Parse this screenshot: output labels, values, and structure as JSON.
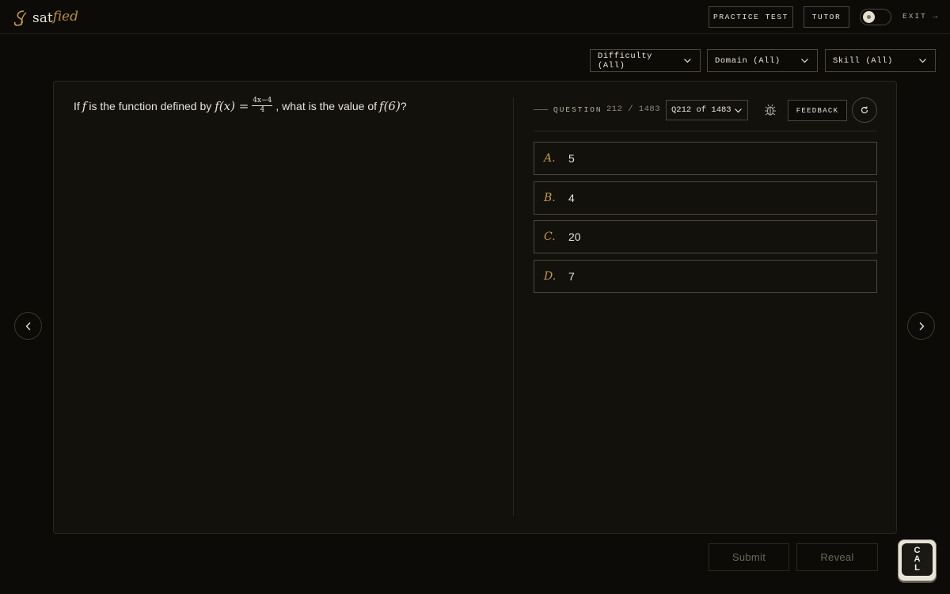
{
  "header": {
    "logo_text": "sat",
    "logo_script": "fied",
    "practice_test": "PRACTICE TEST",
    "tutor": "TUTOR",
    "exit": "EXIT →"
  },
  "filters": {
    "difficulty": "Difficulty (All)",
    "domain": "Domain (All)",
    "skill": "Skill (All)"
  },
  "question": {
    "prefix": "If ",
    "f": "f",
    "mid": " is the function defined by ",
    "fx": "f(x) =",
    "frac_num": "4x−4",
    "frac_den": "4",
    "suffix": ", what is the value of ",
    "f6": "f(6)",
    "end": "?"
  },
  "meta": {
    "label": "QUESTION",
    "count": "212 / 1483",
    "select_value": "Q212 of 1483",
    "feedback": "FEEDBACK"
  },
  "options": [
    {
      "letter": "A.",
      "text": "5"
    },
    {
      "letter": "B.",
      "text": "4"
    },
    {
      "letter": "C.",
      "text": "20"
    },
    {
      "letter": "D.",
      "text": "7"
    }
  ],
  "footer": {
    "submit": "Submit",
    "reveal": "Reveal",
    "calc_c": "C",
    "calc_a": "A",
    "calc_l": "L"
  },
  "colors": {
    "background": "#0c0b07",
    "panel": "#12110c",
    "accent": "#c89a4a",
    "border": "#4c473a"
  },
  "icons": [
    "logo-mark-icon",
    "chevron-down-icon",
    "bug-icon",
    "refresh-icon",
    "chevron-left-icon",
    "chevron-right-icon"
  ]
}
